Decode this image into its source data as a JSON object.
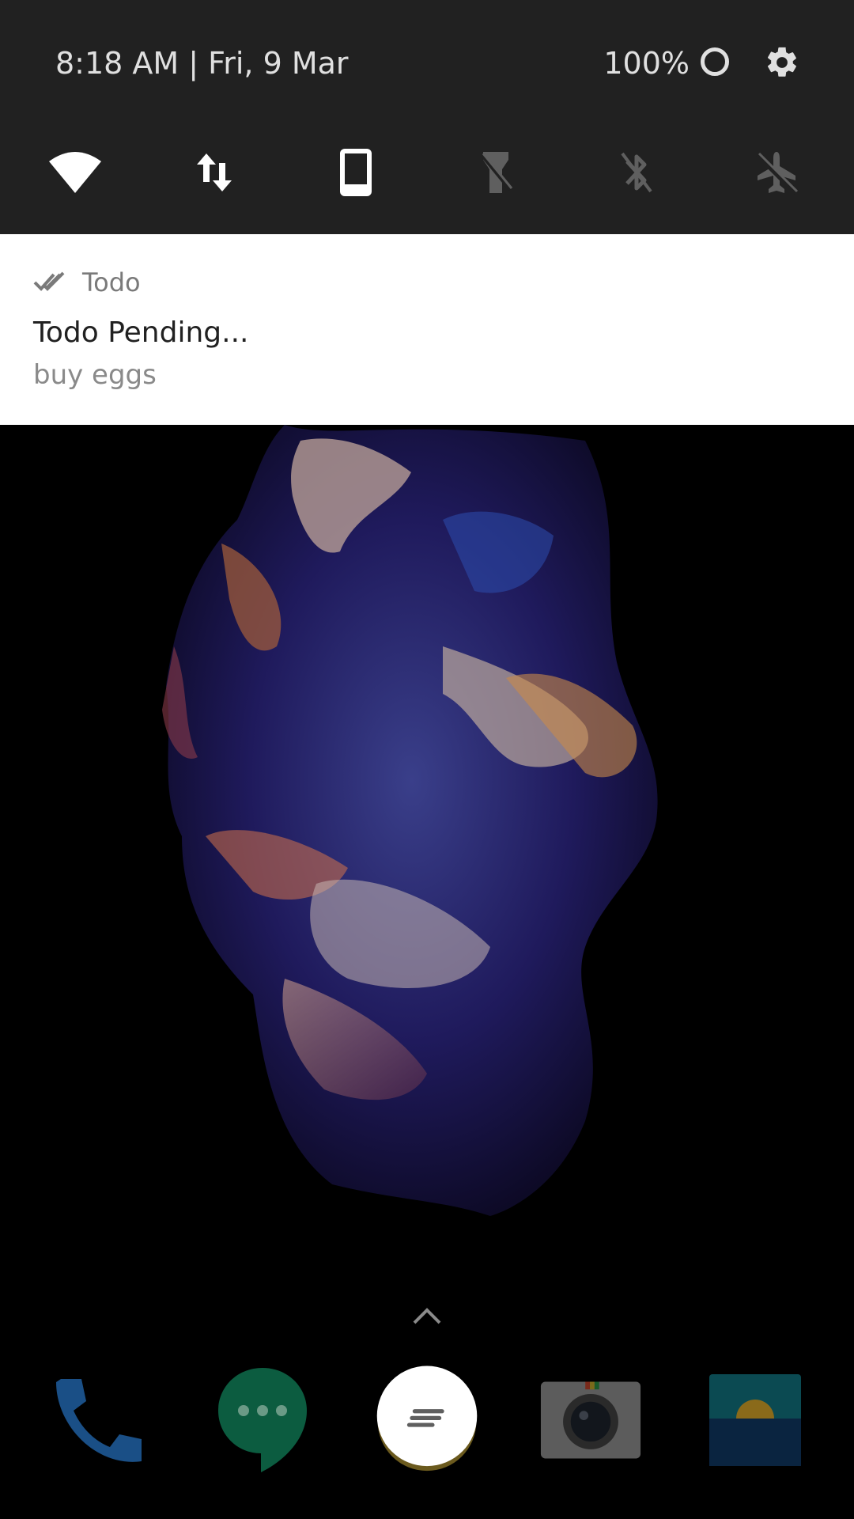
{
  "status_bar": {
    "time_date": "8:18 AM  |  Fri, 9 Mar",
    "battery": "100%"
  },
  "quick_settings": [
    {
      "icon": "wifi-icon",
      "active": true
    },
    {
      "icon": "mobile-data-icon",
      "active": true
    },
    {
      "icon": "screen-orientation-icon",
      "active": true
    },
    {
      "icon": "flashlight-icon",
      "active": false
    },
    {
      "icon": "bluetooth-off-icon",
      "active": false
    },
    {
      "icon": "airplane-mode-icon",
      "active": false
    }
  ],
  "notification": {
    "app_name": "Todo",
    "title": "Todo Pending...",
    "body": "buy eggs"
  },
  "dock": {
    "apps": [
      "phone-icon",
      "hangouts-icon",
      "app-drawer-icon",
      "camera-icon",
      "wallpapers-icon"
    ]
  },
  "colors": {
    "shade_background": "#212121",
    "notification_background": "#ffffff",
    "active_icon": "#ffffff",
    "inactive_icon": "#5f5f5f"
  }
}
